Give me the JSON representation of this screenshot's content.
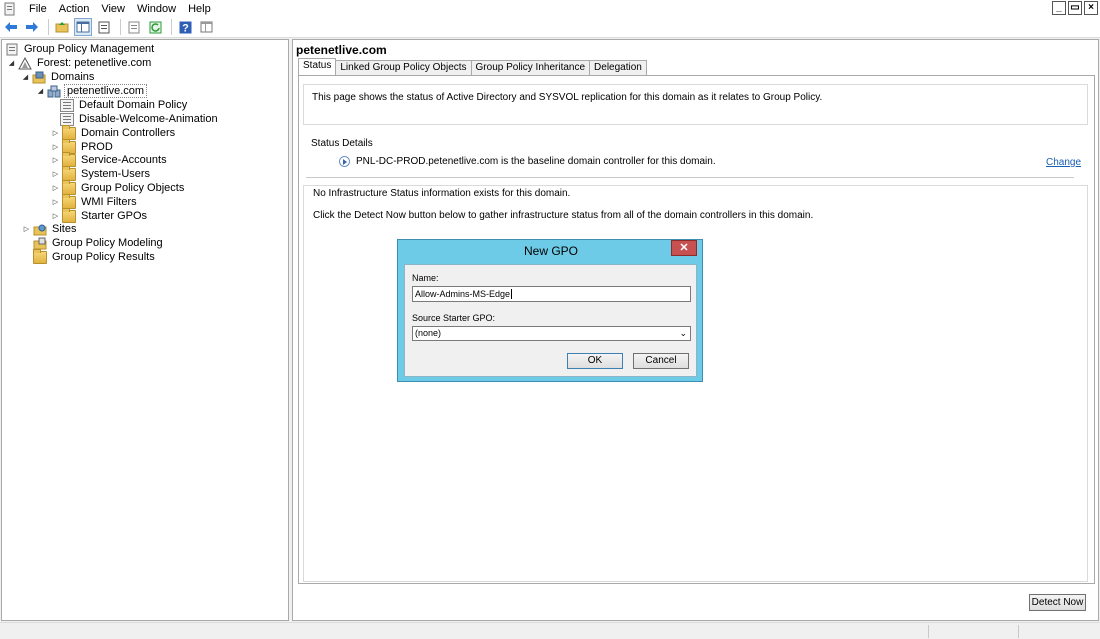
{
  "menu": [
    "File",
    "Action",
    "View",
    "Window",
    "Help"
  ],
  "window_controls": {
    "minimize": "_",
    "restore": "▭",
    "close": "×"
  },
  "toolbar": [
    "back-arrow-icon",
    "forward-arrow-icon",
    "up-folder-icon",
    "show-tree-icon",
    "properties-icon",
    "export-list-icon",
    "refresh-icon",
    "help-icon",
    "console-icon"
  ],
  "tree": {
    "root": "Group Policy Management",
    "forest": "Forest: petenetlive.com",
    "domains": "Domains",
    "domain": "petenetlive.com",
    "items": [
      "Default Domain Policy",
      "Disable-Welcome-Animation",
      "Domain Controllers",
      "PROD",
      "Service-Accounts",
      "System-Users",
      "Group Policy Objects",
      "WMI Filters",
      "Starter GPOs"
    ],
    "sites": "Sites",
    "modeling": "Group Policy Modeling",
    "results": "Group Policy Results"
  },
  "content": {
    "title": "petenetlive.com",
    "tabs": [
      "Status",
      "Linked Group Policy Objects",
      "Group Policy Inheritance",
      "Delegation"
    ],
    "info": "This page shows the status of Active Directory and SYSVOL replication for this domain as it relates to Group Policy.",
    "details_legend": "Status Details",
    "dc_text": "PNL-DC-PROD.petenetlive.com is the baseline domain controller for this domain.",
    "change": "Change",
    "msg1": "No Infrastructure Status information exists for this domain.",
    "msg2": "Click the Detect Now button below to gather infrastructure status from all of the domain controllers in this domain.",
    "detect_now": "Detect Now"
  },
  "dialog": {
    "title": "New GPO",
    "close": "✕",
    "name_label": "Name:",
    "name_value": "Allow-Admins-MS-Edge",
    "source_label": "Source Starter GPO:",
    "source_value": "(none)",
    "ok": "OK",
    "cancel": "Cancel"
  }
}
